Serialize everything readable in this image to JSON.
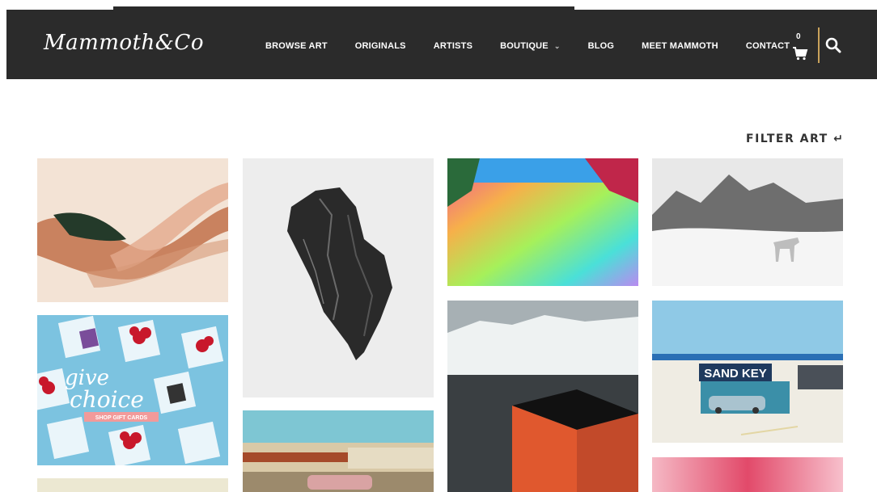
{
  "brand": {
    "logo_text": "Mammoth&Co"
  },
  "nav": {
    "items": [
      {
        "label": "BROWSE ART"
      },
      {
        "label": "ORIGINALS"
      },
      {
        "label": "ARTISTS"
      },
      {
        "label": "BOUTIQUE"
      },
      {
        "label": "BLOG"
      },
      {
        "label": "MEET MAMMOTH"
      },
      {
        "label": "CONTACT"
      }
    ],
    "cart_count": "0"
  },
  "filter": {
    "label": "FILTER ART",
    "icon": "corner-arrow-icon"
  },
  "gift_card": {
    "line1": "give",
    "line2": "choice",
    "button": "SHOP GIFT CARDS"
  },
  "sand_key_sign": "SAND KEY",
  "colors": {
    "navbar": "#2b2b2b",
    "accent": "#c9a35b",
    "gift_pink": "#f29a9a"
  }
}
